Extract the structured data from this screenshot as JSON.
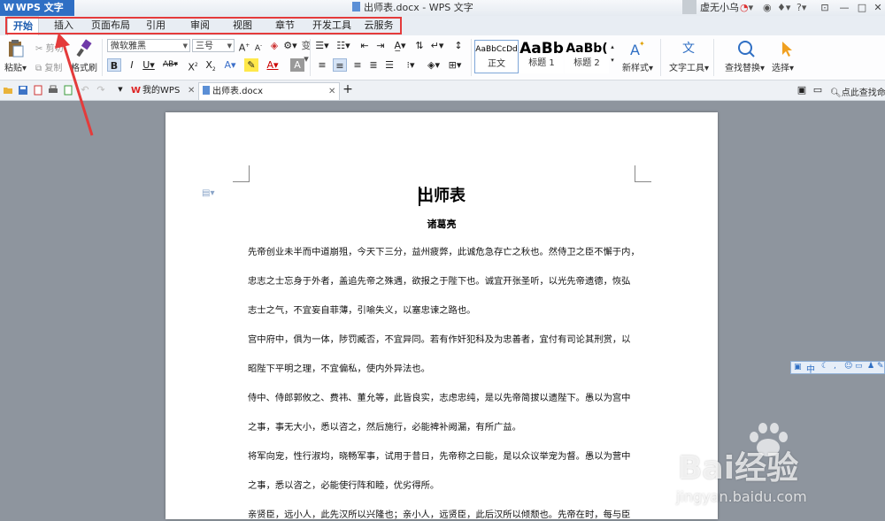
{
  "app": {
    "name": "WPS 文字"
  },
  "window": {
    "title": "出师表.docx - WPS 文字",
    "user": "虚无小乌"
  },
  "menu_tabs": [
    "开始",
    "插入",
    "页面布局",
    "引用",
    "审阅",
    "视图",
    "章节",
    "开发工具",
    "云服务"
  ],
  "ribbon": {
    "paste": "粘贴",
    "cut": "剪切",
    "copy": "复制",
    "format_painter": "格式刷",
    "font_name": "微软雅黑",
    "font_size": "三号",
    "styles": [
      {
        "sample": "AaBbCcDd",
        "name": "正文"
      },
      {
        "sample": "AaBb",
        "name": "标题 1"
      },
      {
        "sample": "AaBb(",
        "name": "标题 2"
      }
    ],
    "new_style": "新样式",
    "text_tools": "文字工具",
    "find_replace": "查找替换",
    "select": "选择"
  },
  "doc_tabs": [
    "我的WPS",
    "出师表.docx"
  ],
  "search_cmd": "点此查找命",
  "document": {
    "title": "出师表",
    "author": "诸葛亮",
    "lines": [
      "先帝创业未半而中道崩殂，今天下三分，益州疲弊，此诚危急存亡之秋也。然侍卫之臣不懈于内，",
      "忠志之士忘身于外者，盖追先帝之殊遇，欲报之于陛下也。诚宜开张圣听，以光先帝遗德，恢弘",
      "志士之气，不宜妄自菲薄，引喻失义，以塞忠谏之路也。",
      "宫中府中，俱为一体，陟罚臧否，不宜异同。若有作奸犯科及为忠善者，宜付有司论其刑赏，以",
      "昭陛下平明之理，不宜偏私，使内外异法也。",
      "侍中、侍郎郭攸之、费祎、董允等，此皆良实，志虑忠纯，是以先帝简拔以遗陛下。愚以为宫中",
      "之事，事无大小，悉以咨之，然后施行，必能裨补阙漏，有所广益。",
      "将军向宠，性行淑均，晓畅军事，试用于昔日，先帝称之曰能，是以众议举宠为督。愚以为营中",
      "之事，悉以咨之，必能使行阵和睦，优劣得所。",
      "亲贤臣，远小人，此先汉所以兴隆也；亲小人，远贤臣，此后汉所以倾颓也。先帝在时，每与臣"
    ]
  },
  "float_bar": {
    "lang": "中"
  },
  "watermark": {
    "brand": "Bai经验",
    "url": "jingyan.baidu.com"
  }
}
